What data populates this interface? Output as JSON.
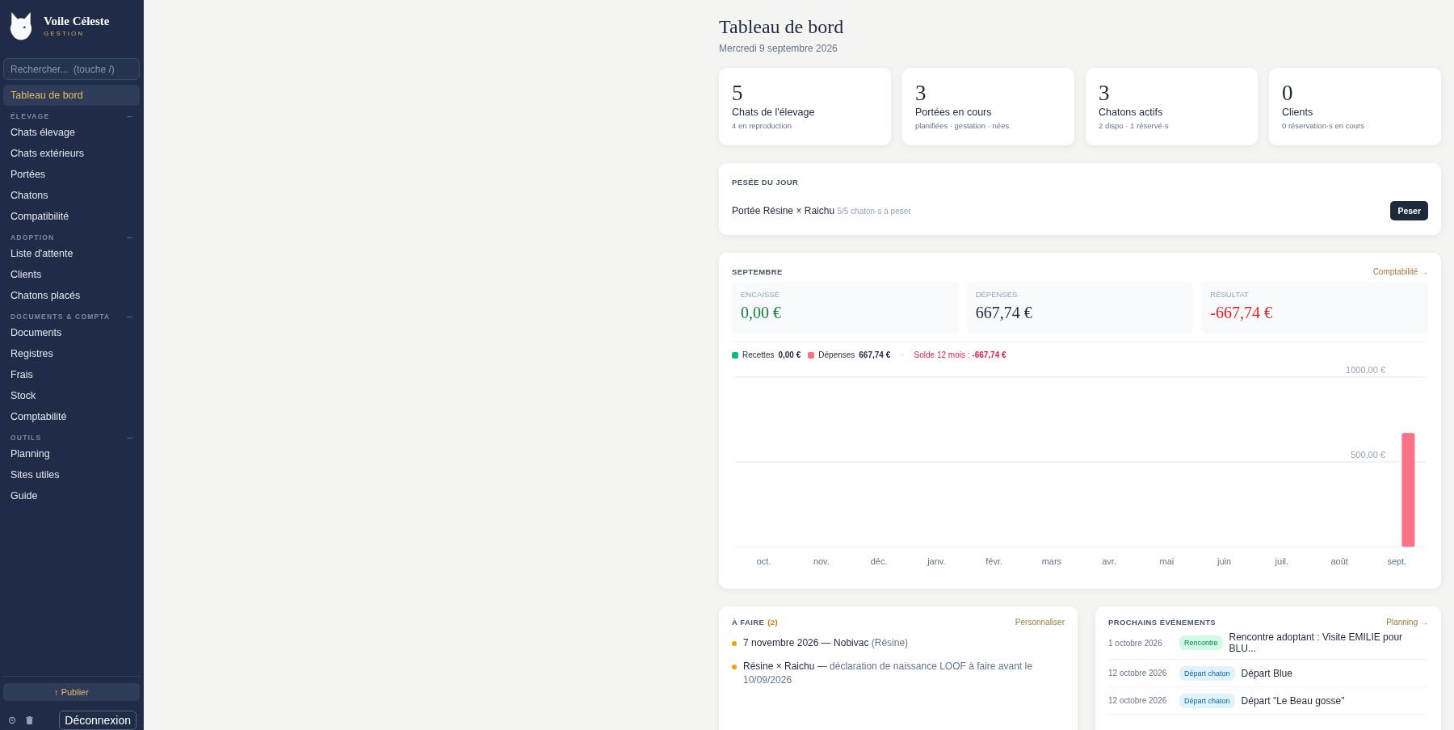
{
  "sidebar": {
    "brand": {
      "name": "Voile Céleste",
      "subtitle": "GESTION"
    },
    "search": {
      "placeholder": "Rechercher...  (touche /)"
    },
    "items": [
      {
        "label": "Tableau de bord",
        "selected": true
      }
    ],
    "sections": [
      {
        "title": "ÉLEVAGE",
        "expanded": true,
        "items": [
          {
            "label": "Chats élevage",
            "selected": false
          },
          {
            "label": "Chats extérieurs",
            "selected": false
          },
          {
            "label": "Portées",
            "selected": false
          },
          {
            "label": "Chatons",
            "selected": false
          },
          {
            "label": "Compatibilité",
            "selected": false
          }
        ]
      },
      {
        "title": "ADOPTION",
        "expanded": true,
        "items": [
          {
            "label": "Liste d'attente",
            "selected": false
          },
          {
            "label": "Clients",
            "selected": false
          },
          {
            "label": "Chatons placés",
            "selected": false
          }
        ]
      },
      {
        "title": "DOCUMENTS & COMPTA",
        "expanded": true,
        "items": [
          {
            "label": "Documents",
            "selected": false
          },
          {
            "label": "Registres",
            "selected": false
          },
          {
            "label": "Frais",
            "selected": false
          },
          {
            "label": "Stock",
            "selected": false
          },
          {
            "label": "Comptabilité",
            "selected": false
          }
        ]
      },
      {
        "title": "OUTILS",
        "expanded": true,
        "items": [
          {
            "label": "Planning",
            "selected": false
          },
          {
            "label": "Sites utiles",
            "selected": false
          },
          {
            "label": "Guide",
            "selected": false
          }
        ]
      }
    ],
    "publish_button": "↑ Publier",
    "logout_button": "Déconnexion"
  },
  "page": {
    "title": "Tableau de bord",
    "date": "Mercredi 9 septembre 2026"
  },
  "stats": [
    {
      "value": "5",
      "label": "Chats de l'élevage",
      "detail": "4 en reproduction"
    },
    {
      "value": "3",
      "label": "Portées en cours",
      "detail": "planifiées · gestation · nées"
    },
    {
      "value": "3",
      "label": "Chatons actifs",
      "detail": "2 dispo · 1 réservé·s"
    },
    {
      "value": "0",
      "label": "Clients",
      "detail": "0 réservation·s en cours"
    }
  ],
  "weighing": {
    "title": "PESÉE DU JOUR",
    "item": "Portée Résine × Raichu",
    "note": "5/5 chaton·s à peser",
    "button": "Peser"
  },
  "finance": {
    "title": "SEPTEMBRE",
    "link": "Comptabilité →",
    "tiles": [
      {
        "label": "ENCAISSÉ",
        "value": "0,00 €",
        "kind": "positive"
      },
      {
        "label": "DÉPENSES",
        "value": "667,74 €",
        "kind": "neutral"
      },
      {
        "label": "RÉSULTAT",
        "value": "-667,74 €",
        "kind": "negative"
      }
    ],
    "legend": [
      {
        "value": "0,00 €"
      },
      {
        "value": "667,74 €"
      }
    ],
    "separator": "·",
    "balance": {
      "label": "Solde 12 mois :",
      "value": "-667,74 €"
    },
    "chart_data": {
      "type": "bar",
      "categories": [
        "oct.",
        "nov.",
        "déc.",
        "janv.",
        "févr.",
        "mars",
        "avr.",
        "mai",
        "juin",
        "juil.",
        "août",
        "sept."
      ],
      "series": [
        {
          "name": "Recettes",
          "color": "#10b981",
          "values": [
            0,
            0,
            0,
            0,
            0,
            0,
            0,
            0,
            0,
            0,
            0,
            0
          ]
        },
        {
          "name": "Dépenses",
          "color": "#fb7185",
          "values": [
            0,
            0,
            0,
            0,
            0,
            0,
            0,
            0,
            0,
            0,
            0,
            670
          ]
        }
      ],
      "ylim": [
        0,
        1000
      ],
      "yticks": [
        {
          "value": 500,
          "label": "500,00 €"
        },
        {
          "value": 1000,
          "label": "1000,00 €"
        }
      ]
    }
  },
  "todo": {
    "title": "À FAIRE",
    "count": "(2)",
    "link": "Personnaliser",
    "items": [
      {
        "main": "7 novembre 2026 — Nobivac",
        "note": "(Résine)"
      },
      {
        "main": "Résine × Raichu —",
        "note": "déclaration de naissance LOOF à faire avant le 10/09/2026"
      }
    ]
  },
  "events": {
    "title": "PROCHAINS ÉVÉNEMENTS",
    "link": "Planning →",
    "items": [
      {
        "date": "1 octobre 2026",
        "tag": "Rencontre",
        "kind": "meeting",
        "title": "Rencontre adoptant : Visite EMILIE pour BLU..."
      },
      {
        "date": "12 octobre 2026",
        "tag": "Départ chaton",
        "kind": "departure",
        "title": "Départ Blue"
      },
      {
        "date": "12 octobre 2026",
        "tag": "Départ chaton",
        "kind": "departure",
        "title": "Départ \"Le Beau gosse\""
      }
    ]
  }
}
